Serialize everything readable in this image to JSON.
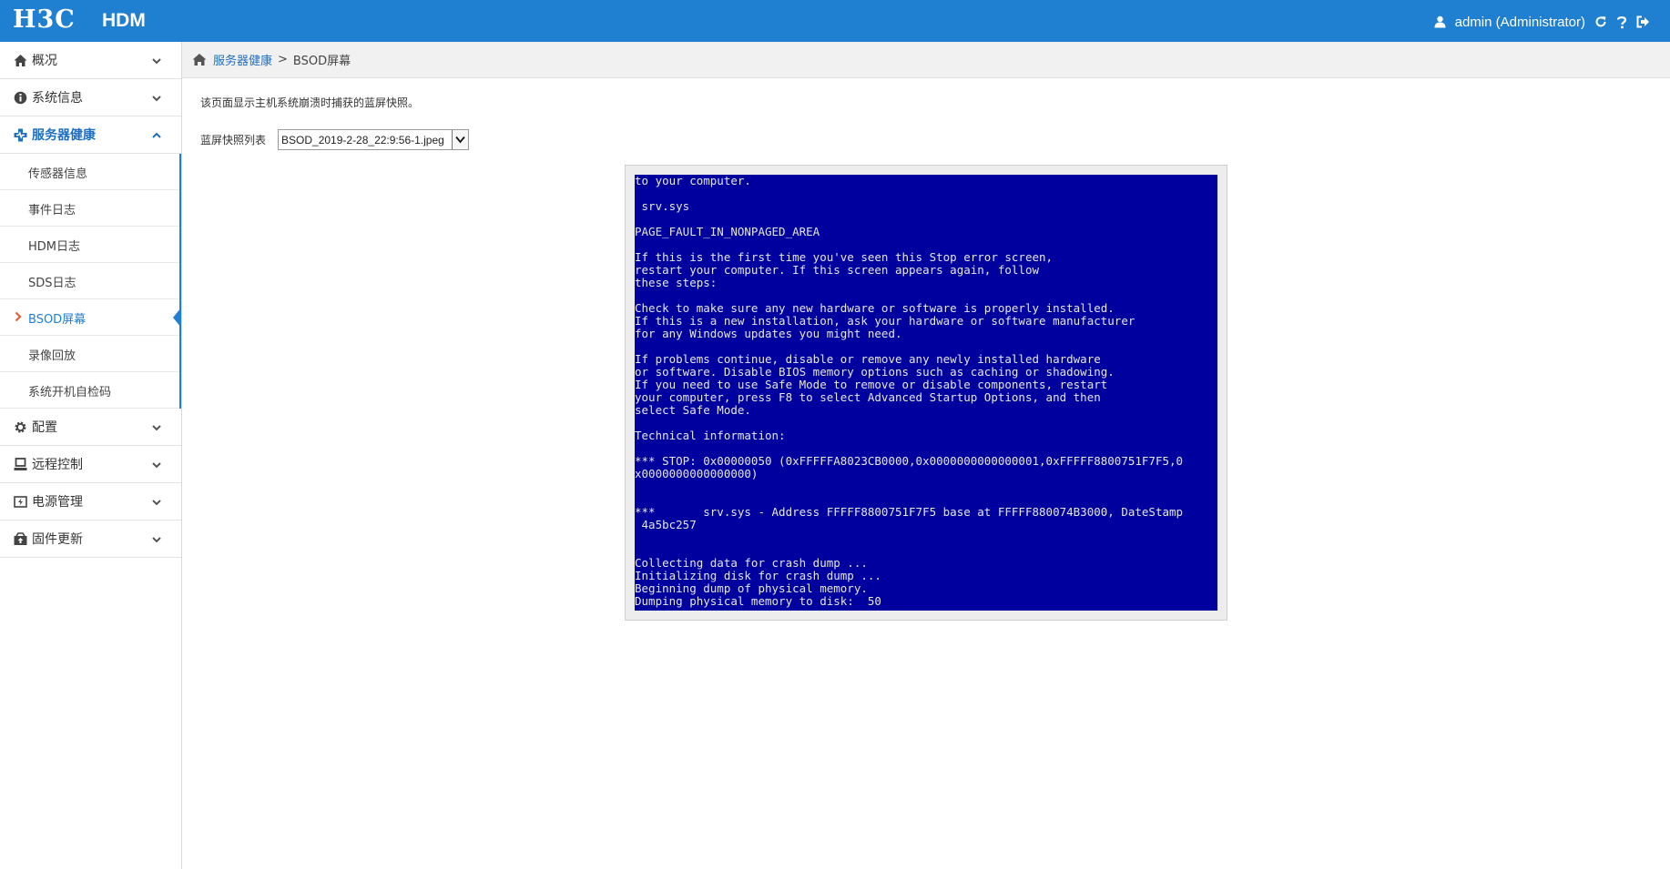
{
  "header": {
    "logo": "H3C",
    "product": "HDM",
    "user": "admin (Administrator)",
    "icons": [
      "user-icon",
      "refresh-icon",
      "help-icon",
      "logout-icon"
    ]
  },
  "sidebar": {
    "groups": [
      {
        "label": "概况",
        "icon": "home-icon"
      },
      {
        "label": "系统信息",
        "icon": "info-icon"
      },
      {
        "label": "服务器健康",
        "icon": "health-icon"
      },
      {
        "label": "配置",
        "icon": "gear-icon"
      },
      {
        "label": "远程控制",
        "icon": "monitor-icon"
      },
      {
        "label": "电源管理",
        "icon": "power-icon"
      },
      {
        "label": "固件更新",
        "icon": "firmware-icon"
      }
    ],
    "health_items": [
      {
        "label": "传感器信息"
      },
      {
        "label": "事件日志"
      },
      {
        "label": "HDM日志"
      },
      {
        "label": "SDS日志"
      },
      {
        "label": "BSOD屏幕"
      },
      {
        "label": "录像回放"
      },
      {
        "label": "系统开机自检码"
      }
    ],
    "active_item": "BSOD屏幕"
  },
  "breadcrumb": {
    "parent": "服务器健康",
    "separator": ">",
    "current": "BSOD屏幕"
  },
  "main": {
    "description": "该页面显示主机系统崩溃时捕获的蓝屏快照。",
    "select_label": "蓝屏快照列表",
    "select_value": "BSOD_2019-2-28_22:9:56-1.jpeg"
  },
  "bsod": {
    "background": "#00009f",
    "lines": [
      "to your computer.",
      "",
      " srv.sys",
      "",
      "PAGE_FAULT_IN_NONPAGED_AREA",
      "",
      "If this is the first time you've seen this Stop error screen,",
      "restart your computer. If this screen appears again, follow",
      "these steps:",
      "",
      "Check to make sure any new hardware or software is properly installed.",
      "If this is a new installation, ask your hardware or software manufacturer",
      "for any Windows updates you might need.",
      "",
      "If problems continue, disable or remove any newly installed hardware",
      "or software. Disable BIOS memory options such as caching or shadowing.",
      "If you need to use Safe Mode to remove or disable components, restart",
      "your computer, press F8 to select Advanced Startup Options, and then",
      "select Safe Mode.",
      "",
      "Technical information:",
      "",
      "*** STOP: 0x00000050 (0xFFFFFA8023CB0000,0x0000000000000001,0xFFFFF8800751F7F5,0",
      "x0000000000000000)",
      "",
      "",
      "***       srv.sys - Address FFFFF8800751F7F5 base at FFFFF880074B3000, DateStamp",
      " 4a5bc257",
      "",
      "",
      "Collecting data for crash dump ...",
      "Initializing disk for crash dump ...",
      "Beginning dump of physical memory.",
      "Dumping physical memory to disk:  50"
    ]
  },
  "colors": {
    "brand_blue": "#1f7fd1",
    "link_blue": "#1f6fc1",
    "active_arrow": "#e8572a"
  }
}
